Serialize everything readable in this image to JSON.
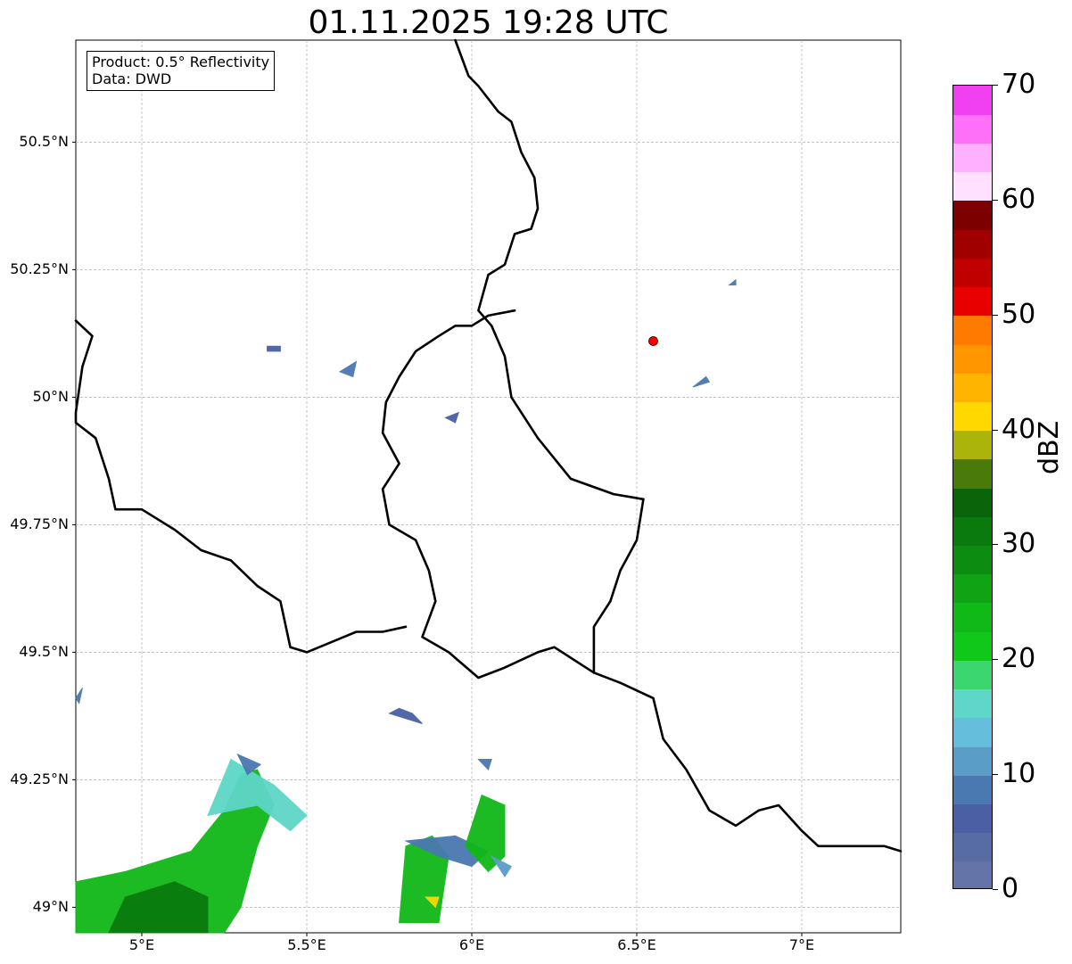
{
  "title": "01.11.2025 19:28 UTC",
  "info": {
    "product": "Product: 0.5° Reflectivity",
    "source": "Data: DWD"
  },
  "axes": {
    "lat_labels": [
      {
        "label": "50.5°N",
        "value": 50.5
      },
      {
        "label": "50.25°N",
        "value": 50.25
      },
      {
        "label": "50°N",
        "value": 50.0
      },
      {
        "label": "49.75°N",
        "value": 49.75
      },
      {
        "label": "49.5°N",
        "value": 49.5
      },
      {
        "label": "49.25°N",
        "value": 49.25
      },
      {
        "label": "49°N",
        "value": 49.0
      }
    ],
    "lon_labels": [
      {
        "label": "5°E",
        "value": 5.0
      },
      {
        "label": "5.5°E",
        "value": 5.5
      },
      {
        "label": "6°E",
        "value": 6.0
      },
      {
        "label": "6.5°E",
        "value": 6.5
      },
      {
        "label": "7°E",
        "value": 7.0
      }
    ],
    "lon_range": [
      4.8,
      7.3
    ],
    "lat_range": [
      48.95,
      50.7
    ],
    "grid": true
  },
  "radar_site": {
    "lon": 6.55,
    "lat": 50.11,
    "color": "#ff0000"
  },
  "colorbar": {
    "label": "dBZ",
    "min": 0,
    "max": 70,
    "step": 2.5,
    "ticks": [
      {
        "label": "0",
        "value": 0
      },
      {
        "label": "10",
        "value": 10
      },
      {
        "label": "20",
        "value": 20
      },
      {
        "label": "30",
        "value": 30
      },
      {
        "label": "40",
        "value": 40
      },
      {
        "label": "50",
        "value": 50
      },
      {
        "label": "60",
        "value": 60
      },
      {
        "label": "70",
        "value": 70
      }
    ],
    "colors": [
      "#6474a8",
      "#586ca4",
      "#4b60a4",
      "#4a78b0",
      "#5a9ec8",
      "#64bedc",
      "#5ed6c8",
      "#3cd670",
      "#10c81a",
      "#10b818",
      "#10a414",
      "#0c8c10",
      "#0a7a0e",
      "#0a640a",
      "#4a7a0a",
      "#aab40a",
      "#ffd800",
      "#ffb400",
      "#ff9600",
      "#ff7a00",
      "#e80000",
      "#c00000",
      "#a00000",
      "#7c0000",
      "#ffe0ff",
      "#ffb0ff",
      "#ff70f8",
      "#f040f0"
    ]
  },
  "echoes": [
    {
      "name": "echo-sw-main",
      "color": "#10b818",
      "points": [
        [
          4.8,
          48.95
        ],
        [
          4.8,
          49.05
        ],
        [
          4.95,
          49.07
        ],
        [
          5.15,
          49.11
        ],
        [
          5.25,
          49.19
        ],
        [
          5.3,
          49.26
        ],
        [
          5.35,
          49.27
        ],
        [
          5.4,
          49.2
        ],
        [
          5.35,
          49.12
        ],
        [
          5.3,
          49.0
        ],
        [
          5.25,
          48.95
        ]
      ]
    },
    {
      "name": "echo-sw-core",
      "color": "#0a7a0e",
      "points": [
        [
          4.9,
          48.95
        ],
        [
          4.95,
          49.02
        ],
        [
          5.1,
          49.05
        ],
        [
          5.2,
          49.02
        ],
        [
          5.2,
          48.95
        ]
      ]
    },
    {
      "name": "echo-sw-fringe",
      "color": "#5ed6c8",
      "points": [
        [
          5.2,
          49.18
        ],
        [
          5.27,
          49.29
        ],
        [
          5.4,
          49.24
        ],
        [
          5.5,
          49.18
        ],
        [
          5.45,
          49.15
        ],
        [
          5.35,
          49.2
        ]
      ]
    },
    {
      "name": "echo-sw-edge",
      "color": "#4a78b0",
      "points": [
        [
          5.29,
          49.3
        ],
        [
          5.36,
          49.28
        ],
        [
          5.32,
          49.26
        ]
      ]
    },
    {
      "name": "echo-center-south",
      "color": "#10b818",
      "points": [
        [
          5.78,
          48.97
        ],
        [
          5.8,
          49.12
        ],
        [
          5.88,
          49.14
        ],
        [
          5.93,
          49.1
        ],
        [
          5.9,
          48.97
        ]
      ]
    },
    {
      "name": "echo-center-south-fringe",
      "color": "#4a78b0",
      "points": [
        [
          5.8,
          49.13
        ],
        [
          5.95,
          49.14
        ],
        [
          6.05,
          49.11
        ],
        [
          6.0,
          49.08
        ],
        [
          5.9,
          49.1
        ]
      ]
    },
    {
      "name": "echo-center-east",
      "color": "#10b818",
      "points": [
        [
          5.98,
          49.12
        ],
        [
          6.03,
          49.22
        ],
        [
          6.1,
          49.2
        ],
        [
          6.1,
          49.1
        ],
        [
          6.05,
          49.07
        ]
      ]
    },
    {
      "name": "echo-center-east-fringe",
      "color": "#5a9ec8",
      "points": [
        [
          6.06,
          49.1
        ],
        [
          6.12,
          49.08
        ],
        [
          6.1,
          49.06
        ]
      ]
    },
    {
      "name": "echo-center-east-top",
      "color": "#4a78b0",
      "points": [
        [
          6.02,
          49.29
        ],
        [
          6.06,
          49.29
        ],
        [
          6.05,
          49.27
        ]
      ]
    },
    {
      "name": "echo-mid",
      "color": "#4a60a4",
      "points": [
        [
          5.75,
          49.38
        ],
        [
          5.85,
          49.36
        ],
        [
          5.82,
          49.38
        ],
        [
          5.78,
          49.39
        ]
      ]
    },
    {
      "name": "echo-yellow-core",
      "color": "#ffd800",
      "points": [
        [
          5.86,
          49.02
        ],
        [
          5.9,
          49.02
        ],
        [
          5.89,
          49.0
        ]
      ]
    },
    {
      "name": "echo-lux-north",
      "color": "#4a60a4",
      "points": [
        [
          5.38,
          50.1
        ],
        [
          5.42,
          50.1
        ],
        [
          5.42,
          50.09
        ],
        [
          5.38,
          50.09
        ]
      ]
    },
    {
      "name": "echo-lux-north-2",
      "color": "#4a78b0",
      "points": [
        [
          5.6,
          50.05
        ],
        [
          5.65,
          50.07
        ],
        [
          5.64,
          50.04
        ]
      ]
    },
    {
      "name": "echo-lux-north-3",
      "color": "#4a60a4",
      "points": [
        [
          5.92,
          49.96
        ],
        [
          5.96,
          49.97
        ],
        [
          5.95,
          49.95
        ]
      ]
    },
    {
      "name": "echo-east-1",
      "color": "#4a78b0",
      "points": [
        [
          6.67,
          50.02
        ],
        [
          6.71,
          50.04
        ],
        [
          6.72,
          50.03
        ]
      ]
    },
    {
      "name": "echo-east-2",
      "color": "#4a78b0",
      "points": [
        [
          6.78,
          50.22
        ],
        [
          6.8,
          50.23
        ],
        [
          6.8,
          50.22
        ]
      ]
    },
    {
      "name": "echo-west-edge",
      "color": "#4a78b0",
      "points": [
        [
          4.8,
          49.41
        ],
        [
          4.82,
          49.43
        ],
        [
          4.81,
          49.4
        ]
      ]
    }
  ],
  "borders": [
    {
      "name": "country-border-north",
      "points": [
        [
          5.95,
          50.7
        ],
        [
          5.99,
          50.63
        ],
        [
          6.02,
          50.61
        ],
        [
          6.08,
          50.56
        ],
        [
          6.12,
          50.54
        ],
        [
          6.15,
          50.48
        ],
        [
          6.19,
          50.43
        ],
        [
          6.2,
          50.37
        ],
        [
          6.18,
          50.33
        ],
        [
          6.13,
          50.32
        ],
        [
          6.1,
          50.26
        ],
        [
          6.05,
          50.24
        ],
        [
          6.02,
          50.17
        ],
        [
          6.06,
          50.14
        ],
        [
          6.1,
          50.08
        ],
        [
          6.12,
          50.0
        ],
        [
          6.2,
          49.92
        ],
        [
          6.3,
          49.84
        ],
        [
          6.43,
          49.81
        ],
        [
          6.52,
          49.8
        ]
      ]
    },
    {
      "name": "country-border-lux-east",
      "points": [
        [
          6.52,
          49.8
        ],
        [
          6.5,
          49.72
        ],
        [
          6.45,
          49.66
        ],
        [
          6.42,
          49.6
        ],
        [
          6.37,
          49.55
        ],
        [
          6.37,
          49.46
        ]
      ]
    },
    {
      "name": "country-border-lux-west",
      "points": [
        [
          6.13,
          50.17
        ],
        [
          6.05,
          50.16
        ],
        [
          6.0,
          50.14
        ],
        [
          5.95,
          50.14
        ],
        [
          5.9,
          50.12
        ],
        [
          5.83,
          50.09
        ],
        [
          5.78,
          50.04
        ],
        [
          5.74,
          49.99
        ],
        [
          5.73,
          49.93
        ],
        [
          5.78,
          49.87
        ],
        [
          5.73,
          49.82
        ],
        [
          5.75,
          49.75
        ],
        [
          5.83,
          49.72
        ],
        [
          5.87,
          49.66
        ],
        [
          5.89,
          49.6
        ],
        [
          5.85,
          49.53
        ],
        [
          5.93,
          49.5
        ],
        [
          6.02,
          49.45
        ],
        [
          6.1,
          49.47
        ],
        [
          6.2,
          49.5
        ],
        [
          6.25,
          49.51
        ],
        [
          6.37,
          49.46
        ]
      ]
    },
    {
      "name": "country-border-west",
      "points": [
        [
          4.8,
          50.15
        ],
        [
          4.85,
          50.12
        ],
        [
          4.82,
          50.06
        ],
        [
          4.8,
          49.97
        ],
        [
          4.8,
          49.95
        ],
        [
          4.86,
          49.92
        ],
        [
          4.9,
          49.84
        ],
        [
          4.92,
          49.78
        ],
        [
          5.0,
          49.78
        ],
        [
          5.1,
          49.74
        ],
        [
          5.18,
          49.7
        ],
        [
          5.27,
          49.68
        ],
        [
          5.35,
          49.63
        ],
        [
          5.42,
          49.6
        ],
        [
          5.45,
          49.51
        ],
        [
          5.5,
          49.5
        ],
        [
          5.65,
          49.54
        ],
        [
          5.73,
          49.54
        ],
        [
          5.8,
          49.55
        ]
      ]
    },
    {
      "name": "country-border-east",
      "points": [
        [
          6.37,
          49.46
        ],
        [
          6.45,
          49.44
        ],
        [
          6.55,
          49.41
        ],
        [
          6.58,
          49.33
        ],
        [
          6.65,
          49.27
        ],
        [
          6.72,
          49.19
        ],
        [
          6.8,
          49.16
        ],
        [
          6.87,
          49.19
        ],
        [
          6.93,
          49.2
        ],
        [
          7.0,
          49.15
        ],
        [
          7.05,
          49.12
        ],
        [
          7.15,
          49.12
        ],
        [
          7.25,
          49.12
        ],
        [
          7.3,
          49.11
        ]
      ]
    }
  ]
}
